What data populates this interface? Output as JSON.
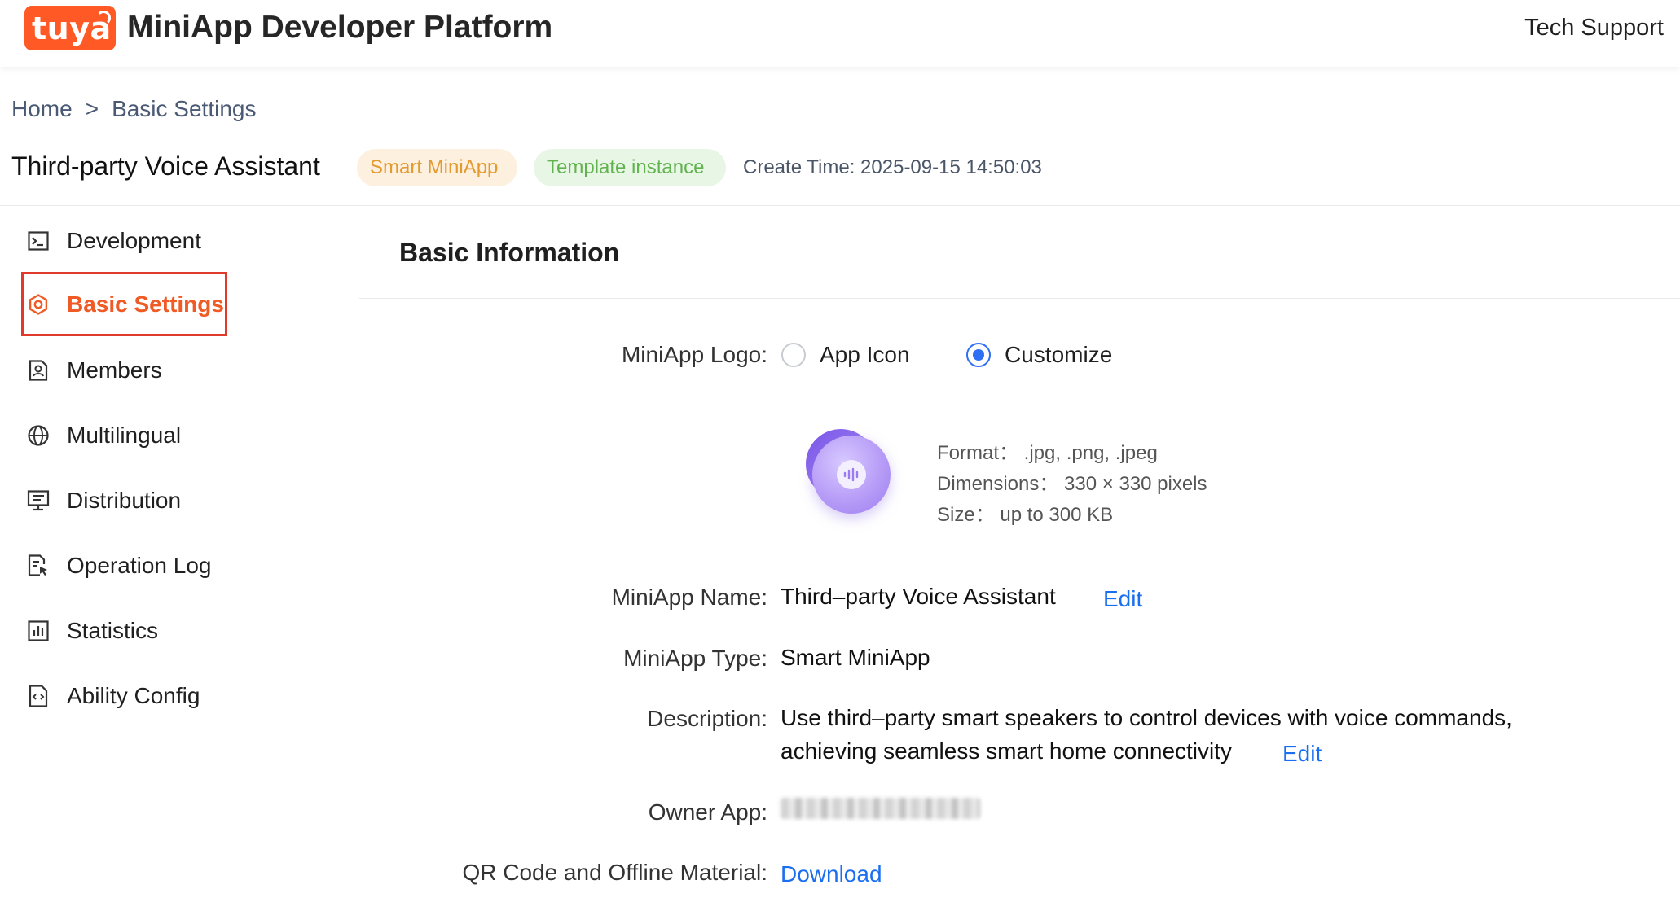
{
  "header": {
    "logo_text": "tuya",
    "title": "MiniApp Developer Platform",
    "tech_support": "Tech Support"
  },
  "breadcrumb": {
    "home": "Home",
    "separator": ">",
    "current": "Basic Settings"
  },
  "app": {
    "name": "Third-party Voice Assistant",
    "badges": [
      "Smart MiniApp",
      "Template instance"
    ],
    "create_time": "Create Time: 2025-09-15 14:50:03"
  },
  "sidebar": {
    "items": [
      {
        "label": "Development",
        "icon": "terminal-icon"
      },
      {
        "label": "Basic Settings",
        "icon": "gear-icon",
        "active": true
      },
      {
        "label": "Members",
        "icon": "member-card-icon"
      },
      {
        "label": "Multilingual",
        "icon": "globe-icon"
      },
      {
        "label": "Distribution",
        "icon": "monitor-icon"
      },
      {
        "label": "Operation Log",
        "icon": "log-document-icon"
      },
      {
        "label": "Statistics",
        "icon": "bar-chart-icon"
      },
      {
        "label": "Ability Config",
        "icon": "code-document-icon"
      }
    ]
  },
  "main": {
    "section_title": "Basic Information",
    "logo": {
      "label": "MiniApp Logo:",
      "options": [
        "App Icon",
        "Customize"
      ],
      "selected": "Customize",
      "format": "Format： .jpg, .png, .jpeg",
      "dimensions": "Dimensions： 330 × 330 pixels",
      "size": "Size： up to 300 KB"
    },
    "name": {
      "label": "MiniApp Name:",
      "value": "Third–party Voice Assistant",
      "edit": "Edit"
    },
    "type": {
      "label": "MiniApp Type:",
      "value": "Smart MiniApp"
    },
    "description": {
      "label": "Description:",
      "line1": "Use third–party smart speakers to control devices with voice commands,",
      "line2": "achieving seamless smart home connectivity",
      "edit": "Edit"
    },
    "owner": {
      "label": "Owner App:"
    },
    "qr": {
      "label": "QR Code and Offline Material:",
      "download": "Download"
    }
  },
  "colors": {
    "brand": "#ff5a26",
    "active": "#f05a24",
    "link": "#1a6ef0",
    "highlight_box": "#e03a2c"
  }
}
